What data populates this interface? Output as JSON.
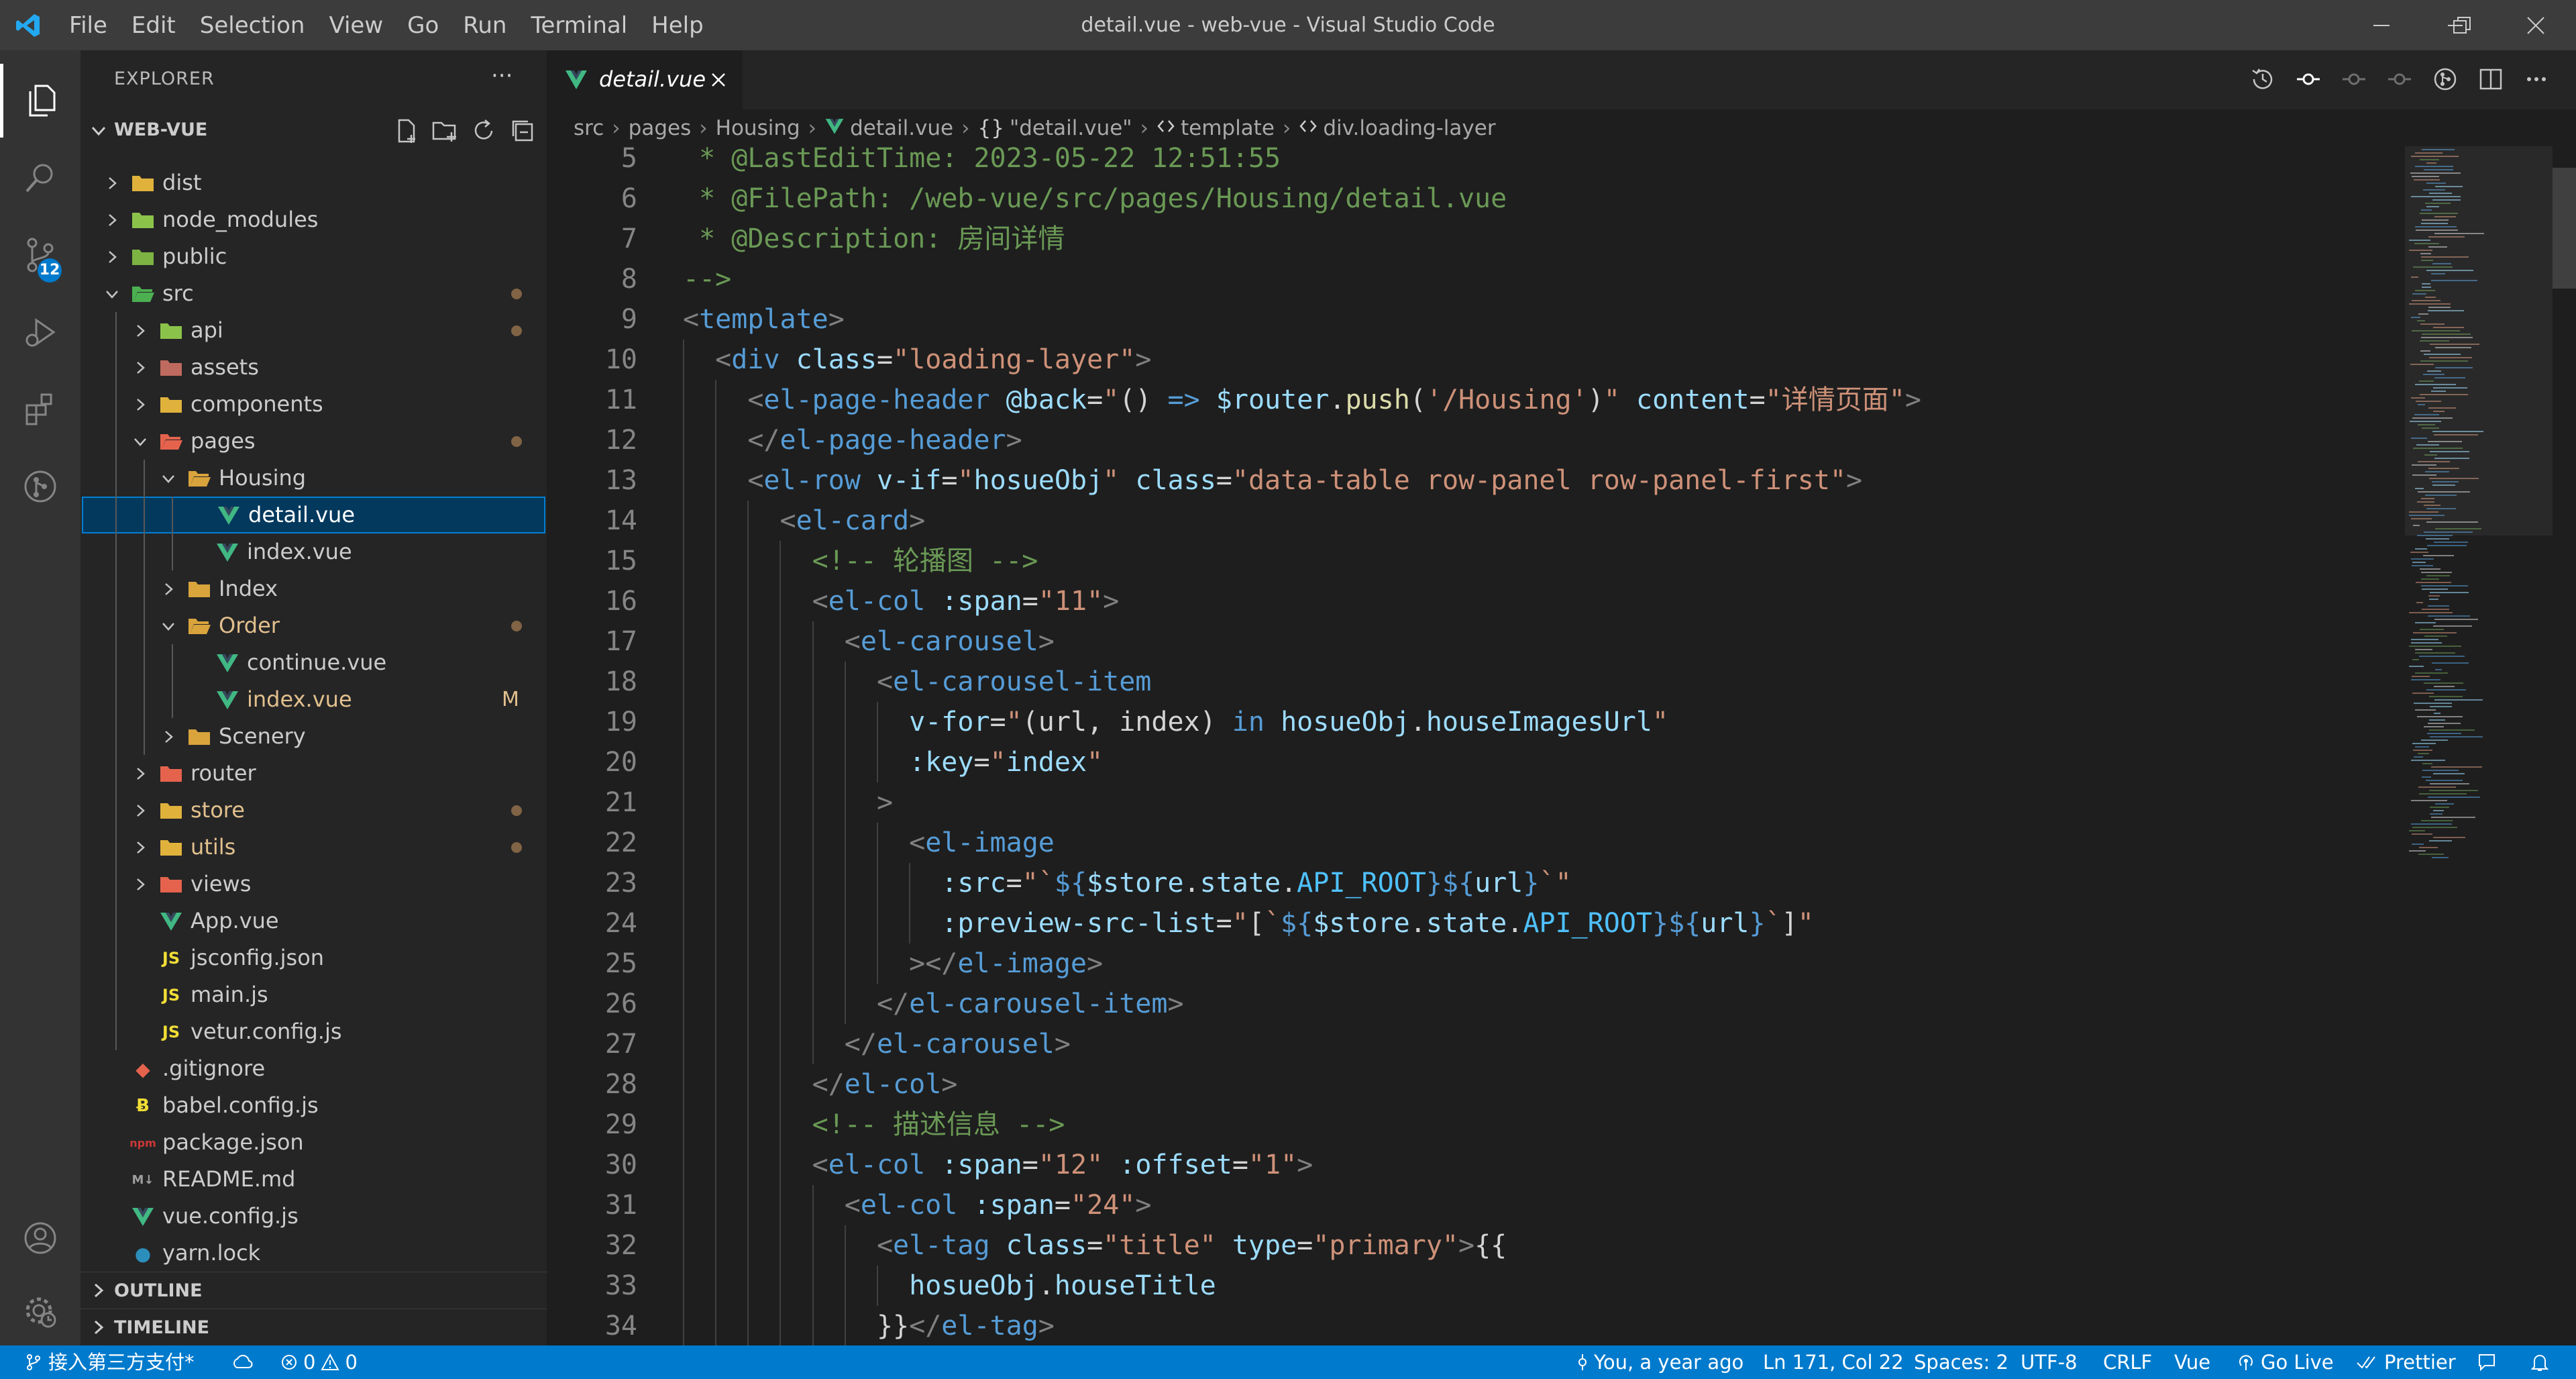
{
  "window": {
    "title": "detail.vue - web-vue - Visual Studio Code",
    "menu": [
      "File",
      "Edit",
      "Selection",
      "View",
      "Go",
      "Run",
      "Terminal",
      "Help"
    ]
  },
  "activity": {
    "scm_badge": "12"
  },
  "sidebar": {
    "title": "EXPLORER",
    "more": "···",
    "workspace": "WEB-VUE",
    "tree": [
      {
        "name": "dist",
        "depth": 0,
        "kind": "folder",
        "open": false,
        "icon": "dist-folder-icon",
        "color": "#e0b23c"
      },
      {
        "name": "node_modules",
        "depth": 0,
        "kind": "folder",
        "open": false,
        "icon": "node-modules-folder-icon",
        "color": "#8bc34a"
      },
      {
        "name": "public",
        "depth": 0,
        "kind": "folder",
        "open": false,
        "icon": "public-folder-icon",
        "color": "#7cb342"
      },
      {
        "name": "src",
        "depth": 0,
        "kind": "folder",
        "open": true,
        "icon": "src-folder-icon",
        "color": "#4caf50",
        "dot": true
      },
      {
        "name": "api",
        "depth": 1,
        "kind": "folder",
        "open": false,
        "icon": "api-folder-icon",
        "color": "#8bc34a",
        "dot": true
      },
      {
        "name": "assets",
        "depth": 1,
        "kind": "folder",
        "open": false,
        "icon": "assets-folder-icon",
        "color": "#bf6a5e"
      },
      {
        "name": "components",
        "depth": 1,
        "kind": "folder",
        "open": false,
        "icon": "components-folder-icon",
        "color": "#e0b23c"
      },
      {
        "name": "pages",
        "depth": 1,
        "kind": "folder",
        "open": true,
        "icon": "pages-folder-icon",
        "color": "#e5634d",
        "dot": true
      },
      {
        "name": "Housing",
        "depth": 2,
        "kind": "folder",
        "open": true,
        "icon": "folder-open-icon",
        "color": "#d9a43c"
      },
      {
        "name": "detail.vue",
        "depth": 3,
        "kind": "vue",
        "selected": true,
        "icon": "vue-file-icon",
        "color": "#41b883"
      },
      {
        "name": "index.vue",
        "depth": 3,
        "kind": "vue",
        "icon": "vue-file-icon",
        "color": "#41b883"
      },
      {
        "name": "Index",
        "depth": 2,
        "kind": "folder",
        "open": false,
        "icon": "folder-icon",
        "color": "#d9a43c"
      },
      {
        "name": "Order",
        "depth": 2,
        "kind": "folder",
        "open": true,
        "icon": "folder-open-icon",
        "color": "#d9a43c",
        "dot": true,
        "modified": true
      },
      {
        "name": "continue.vue",
        "depth": 3,
        "kind": "vue",
        "icon": "vue-file-icon",
        "color": "#41b883"
      },
      {
        "name": "index.vue",
        "depth": 3,
        "kind": "vue",
        "icon": "vue-file-icon",
        "color": "#41b883",
        "flag": "M",
        "modified": true
      },
      {
        "name": "Scenery",
        "depth": 2,
        "kind": "folder",
        "open": false,
        "icon": "folder-icon",
        "color": "#d9a43c"
      },
      {
        "name": "router",
        "depth": 1,
        "kind": "folder",
        "open": false,
        "icon": "router-folder-icon",
        "color": "#e5634d"
      },
      {
        "name": "store",
        "depth": 1,
        "kind": "folder",
        "open": false,
        "icon": "store-folder-icon",
        "color": "#e0b23c",
        "dot": true,
        "modified": true
      },
      {
        "name": "utils",
        "depth": 1,
        "kind": "folder",
        "open": false,
        "icon": "utils-folder-icon",
        "color": "#e0b23c",
        "dot": true,
        "modified": true
      },
      {
        "name": "views",
        "depth": 1,
        "kind": "folder",
        "open": false,
        "icon": "views-folder-icon",
        "color": "#e5634d"
      },
      {
        "name": "App.vue",
        "depth": 1,
        "kind": "vue",
        "icon": "vue-file-icon",
        "color": "#41b883"
      },
      {
        "name": "jsconfig.json",
        "depth": 1,
        "kind": "js",
        "icon": "js-file-icon",
        "color": "#f1dd35"
      },
      {
        "name": "main.js",
        "depth": 1,
        "kind": "js",
        "icon": "js-file-icon",
        "color": "#f1dd35"
      },
      {
        "name": "vetur.config.js",
        "depth": 1,
        "kind": "js",
        "icon": "js-file-icon",
        "color": "#f1dd35"
      },
      {
        "name": ".gitignore",
        "depth": 0,
        "kind": "git",
        "icon": "git-file-icon",
        "color": "#e5634d"
      },
      {
        "name": "babel.config.js",
        "depth": 0,
        "kind": "babel",
        "icon": "babel-file-icon",
        "color": "#f1dd35"
      },
      {
        "name": "package.json",
        "depth": 0,
        "kind": "npm",
        "icon": "npm-file-icon",
        "color": "#cb3837"
      },
      {
        "name": "README.md",
        "depth": 0,
        "kind": "md",
        "icon": "markdown-file-icon",
        "color": "#9e9e9e"
      },
      {
        "name": "vue.config.js",
        "depth": 0,
        "kind": "vue",
        "icon": "vue-config-file-icon",
        "color": "#41b883"
      },
      {
        "name": "yarn.lock",
        "depth": 0,
        "kind": "yarn",
        "icon": "yarn-file-icon",
        "color": "#2c8ebb"
      }
    ],
    "outline": "OUTLINE",
    "timeline": "TIMELINE"
  },
  "tab": {
    "label": "detail.vue"
  },
  "breadcrumb": [
    {
      "label": "src",
      "icon": ""
    },
    {
      "label": "pages",
      "icon": ""
    },
    {
      "label": "Housing",
      "icon": ""
    },
    {
      "label": "detail.vue",
      "icon": "vue-breadcrumb-icon"
    },
    {
      "label": "\"detail.vue\"",
      "icon": "braces-breadcrumb-icon"
    },
    {
      "label": "template",
      "icon": "element-breadcrumb-icon"
    },
    {
      "label": "div.loading-layer",
      "icon": "element-breadcrumb-icon"
    }
  ],
  "code": [
    {
      "n": "5",
      "indent": 0,
      "t": [
        [
          "c-cmt",
          " * @LastEditTime: 2023-05-22 12:51:55"
        ]
      ]
    },
    {
      "n": "6",
      "indent": 0,
      "t": [
        [
          "c-cmt",
          " * @FilePath: /web-vue/src/pages/Housing/detail.vue"
        ]
      ]
    },
    {
      "n": "7",
      "indent": 0,
      "t": [
        [
          "c-cmt",
          " * @Description: 房间详情"
        ]
      ]
    },
    {
      "n": "8",
      "indent": 0,
      "t": [
        [
          "c-cmt",
          "-->"
        ]
      ]
    },
    {
      "n": "9",
      "indent": 0,
      "t": [
        [
          "c-punc",
          "<"
        ],
        [
          "c-tag",
          "template"
        ],
        [
          "c-punc",
          ">"
        ]
      ]
    },
    {
      "n": "10",
      "indent": 1,
      "t": [
        [
          "c-punc",
          "<"
        ],
        [
          "c-tag",
          "div"
        ],
        [
          "c-txt",
          " "
        ],
        [
          "c-attr",
          "class"
        ],
        [
          "c-txt",
          "="
        ],
        [
          "c-str",
          "\"loading-layer\""
        ],
        [
          "c-punc",
          ">"
        ]
      ]
    },
    {
      "n": "11",
      "indent": 2,
      "t": [
        [
          "c-punc",
          "<"
        ],
        [
          "c-tag",
          "el-page-header"
        ],
        [
          "c-txt",
          " "
        ],
        [
          "c-attr",
          "@back"
        ],
        [
          "c-txt",
          "="
        ],
        [
          "c-str",
          "\""
        ],
        [
          "c-txt",
          "() "
        ],
        [
          "c-kw",
          "=>"
        ],
        [
          "c-txt",
          " "
        ],
        [
          "c-var",
          "$router"
        ],
        [
          "c-txt",
          "."
        ],
        [
          "c-fn",
          "push"
        ],
        [
          "c-txt",
          "("
        ],
        [
          "c-str",
          "'/Housing'"
        ],
        [
          "c-txt",
          ")"
        ],
        [
          "c-str",
          "\""
        ],
        [
          "c-txt",
          " "
        ],
        [
          "c-attr",
          "content"
        ],
        [
          "c-txt",
          "="
        ],
        [
          "c-str",
          "\"详情页面\""
        ],
        [
          "c-punc",
          ">"
        ]
      ]
    },
    {
      "n": "12",
      "indent": 2,
      "t": [
        [
          "c-punc",
          "</"
        ],
        [
          "c-tag",
          "el-page-header"
        ],
        [
          "c-punc",
          ">"
        ]
      ]
    },
    {
      "n": "13",
      "indent": 2,
      "t": [
        [
          "c-punc",
          "<"
        ],
        [
          "c-tag",
          "el-row"
        ],
        [
          "c-txt",
          " "
        ],
        [
          "c-attr",
          "v-if"
        ],
        [
          "c-txt",
          "="
        ],
        [
          "c-str",
          "\""
        ],
        [
          "c-var",
          "hosueObj"
        ],
        [
          "c-str",
          "\""
        ],
        [
          "c-txt",
          " "
        ],
        [
          "c-attr",
          "class"
        ],
        [
          "c-txt",
          "="
        ],
        [
          "c-str",
          "\"data-table row-panel row-panel-first\""
        ],
        [
          "c-punc",
          ">"
        ]
      ]
    },
    {
      "n": "14",
      "indent": 3,
      "t": [
        [
          "c-punc",
          "<"
        ],
        [
          "c-tag",
          "el-card"
        ],
        [
          "c-punc",
          ">"
        ]
      ]
    },
    {
      "n": "15",
      "indent": 4,
      "t": [
        [
          "c-cmt",
          "<!-- 轮播图 -->"
        ]
      ]
    },
    {
      "n": "16",
      "indent": 4,
      "t": [
        [
          "c-punc",
          "<"
        ],
        [
          "c-tag",
          "el-col"
        ],
        [
          "c-txt",
          " "
        ],
        [
          "c-attr",
          ":span"
        ],
        [
          "c-txt",
          "="
        ],
        [
          "c-str",
          "\"11\""
        ],
        [
          "c-punc",
          ">"
        ]
      ]
    },
    {
      "n": "17",
      "indent": 5,
      "t": [
        [
          "c-punc",
          "<"
        ],
        [
          "c-tag",
          "el-carousel"
        ],
        [
          "c-punc",
          ">"
        ]
      ]
    },
    {
      "n": "18",
      "indent": 6,
      "t": [
        [
          "c-punc",
          "<"
        ],
        [
          "c-tag",
          "el-carousel-item"
        ]
      ]
    },
    {
      "n": "19",
      "indent": 7,
      "t": [
        [
          "c-attr",
          "v-for"
        ],
        [
          "c-txt",
          "="
        ],
        [
          "c-str",
          "\""
        ],
        [
          "c-txt",
          "(url, index) "
        ],
        [
          "c-kw",
          "in"
        ],
        [
          "c-txt",
          " "
        ],
        [
          "c-var",
          "hosueObj"
        ],
        [
          "c-txt",
          "."
        ],
        [
          "c-var",
          "houseImagesUrl"
        ],
        [
          "c-str",
          "\""
        ]
      ]
    },
    {
      "n": "20",
      "indent": 7,
      "t": [
        [
          "c-attr",
          ":key"
        ],
        [
          "c-txt",
          "="
        ],
        [
          "c-str",
          "\""
        ],
        [
          "c-var",
          "index"
        ],
        [
          "c-str",
          "\""
        ]
      ]
    },
    {
      "n": "21",
      "indent": 6,
      "t": [
        [
          "c-punc",
          ">"
        ]
      ]
    },
    {
      "n": "22",
      "indent": 7,
      "t": [
        [
          "c-punc",
          "<"
        ],
        [
          "c-tag",
          "el-image"
        ]
      ]
    },
    {
      "n": "23",
      "indent": 8,
      "t": [
        [
          "c-attr",
          ":src"
        ],
        [
          "c-txt",
          "="
        ],
        [
          "c-str",
          "\""
        ],
        [
          "c-str",
          "`"
        ],
        [
          "c-kw",
          "${"
        ],
        [
          "c-var",
          "$store"
        ],
        [
          "c-txt",
          "."
        ],
        [
          "c-var",
          "state"
        ],
        [
          "c-txt",
          "."
        ],
        [
          "c-const",
          "API_ROOT"
        ],
        [
          "c-kw",
          "}${"
        ],
        [
          "c-var",
          "url"
        ],
        [
          "c-kw",
          "}"
        ],
        [
          "c-str",
          "`"
        ],
        [
          "c-str",
          "\""
        ]
      ]
    },
    {
      "n": "24",
      "indent": 8,
      "t": [
        [
          "c-attr",
          ":preview-src-list"
        ],
        [
          "c-txt",
          "="
        ],
        [
          "c-str",
          "\""
        ],
        [
          "c-txt",
          "["
        ],
        [
          "c-str",
          "`"
        ],
        [
          "c-kw",
          "${"
        ],
        [
          "c-var",
          "$store"
        ],
        [
          "c-txt",
          "."
        ],
        [
          "c-var",
          "state"
        ],
        [
          "c-txt",
          "."
        ],
        [
          "c-const",
          "API_ROOT"
        ],
        [
          "c-kw",
          "}${"
        ],
        [
          "c-var",
          "url"
        ],
        [
          "c-kw",
          "}"
        ],
        [
          "c-str",
          "`"
        ],
        [
          "c-txt",
          "]"
        ],
        [
          "c-str",
          "\""
        ]
      ]
    },
    {
      "n": "25",
      "indent": 7,
      "t": [
        [
          "c-punc",
          "></"
        ],
        [
          "c-tag",
          "el-image"
        ],
        [
          "c-punc",
          ">"
        ]
      ]
    },
    {
      "n": "26",
      "indent": 6,
      "t": [
        [
          "c-punc",
          "</"
        ],
        [
          "c-tag",
          "el-carousel-item"
        ],
        [
          "c-punc",
          ">"
        ]
      ]
    },
    {
      "n": "27",
      "indent": 5,
      "t": [
        [
          "c-punc",
          "</"
        ],
        [
          "c-tag",
          "el-carousel"
        ],
        [
          "c-punc",
          ">"
        ]
      ]
    },
    {
      "n": "28",
      "indent": 4,
      "t": [
        [
          "c-punc",
          "</"
        ],
        [
          "c-tag",
          "el-col"
        ],
        [
          "c-punc",
          ">"
        ]
      ]
    },
    {
      "n": "29",
      "indent": 4,
      "t": [
        [
          "c-cmt",
          "<!-- 描述信息 -->"
        ]
      ]
    },
    {
      "n": "30",
      "indent": 4,
      "t": [
        [
          "c-punc",
          "<"
        ],
        [
          "c-tag",
          "el-col"
        ],
        [
          "c-txt",
          " "
        ],
        [
          "c-attr",
          ":span"
        ],
        [
          "c-txt",
          "="
        ],
        [
          "c-str",
          "\"12\""
        ],
        [
          "c-txt",
          " "
        ],
        [
          "c-attr",
          ":offset"
        ],
        [
          "c-txt",
          "="
        ],
        [
          "c-str",
          "\"1\""
        ],
        [
          "c-punc",
          ">"
        ]
      ]
    },
    {
      "n": "31",
      "indent": 5,
      "t": [
        [
          "c-punc",
          "<"
        ],
        [
          "c-tag",
          "el-col"
        ],
        [
          "c-txt",
          " "
        ],
        [
          "c-attr",
          ":span"
        ],
        [
          "c-txt",
          "="
        ],
        [
          "c-str",
          "\"24\""
        ],
        [
          "c-punc",
          ">"
        ]
      ]
    },
    {
      "n": "32",
      "indent": 6,
      "t": [
        [
          "c-punc",
          "<"
        ],
        [
          "c-tag",
          "el-tag"
        ],
        [
          "c-txt",
          " "
        ],
        [
          "c-attr",
          "class"
        ],
        [
          "c-txt",
          "="
        ],
        [
          "c-str",
          "\"title\""
        ],
        [
          "c-txt",
          " "
        ],
        [
          "c-attr",
          "type"
        ],
        [
          "c-txt",
          "="
        ],
        [
          "c-str",
          "\"primary\""
        ],
        [
          "c-punc",
          ">"
        ],
        [
          "c-brace",
          "{{"
        ]
      ]
    },
    {
      "n": "33",
      "indent": 7,
      "t": [
        [
          "c-var",
          "hosueObj"
        ],
        [
          "c-txt",
          "."
        ],
        [
          "c-var",
          "houseTitle"
        ]
      ]
    },
    {
      "n": "34",
      "indent": 6,
      "t": [
        [
          "c-brace",
          "}}"
        ],
        [
          "c-punc",
          "</"
        ],
        [
          "c-tag",
          "el-tag"
        ],
        [
          "c-punc",
          ">"
        ]
      ]
    }
  ],
  "status": {
    "branch": "接入第三方支付*",
    "errors": "0",
    "warnings": "0",
    "blame": "You, a year ago",
    "position": "Ln 171, Col 22",
    "spaces": "Spaces: 2",
    "encoding": "UTF-8",
    "eol": "CRLF",
    "language": "Vue",
    "golive": "Go Live",
    "prettier": "Prettier"
  }
}
